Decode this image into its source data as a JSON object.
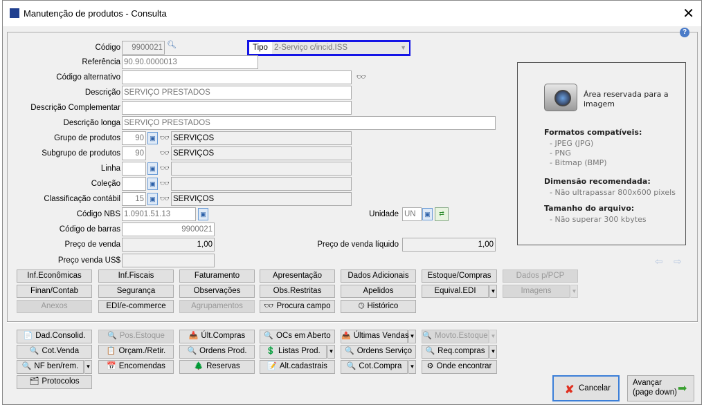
{
  "window": {
    "title": "Manutenção de produtos - Consulta"
  },
  "form": {
    "codigo": {
      "label": "Código",
      "value": "9900021"
    },
    "tipo": {
      "label": "Tipo",
      "value": "2-Serviço c/incid.ISS"
    },
    "referencia": {
      "label": "Referência",
      "value": "90.90.0000013"
    },
    "codigo_alternativo": {
      "label": "Código alternativo",
      "value": ""
    },
    "descricao": {
      "label": "Descrição",
      "value": "SERVIÇO PRESTADOS"
    },
    "descricao_complementar": {
      "label": "Descrição Complementar",
      "value": ""
    },
    "descricao_longa": {
      "label": "Descrição longa",
      "value": "SERVIÇO PRESTADOS"
    },
    "grupo": {
      "label": "Grupo de produtos",
      "code": "90",
      "desc": "SERVIÇOS"
    },
    "subgrupo": {
      "label": "Subgrupo de produtos",
      "code": "90",
      "desc": "SERVIÇOS"
    },
    "linha": {
      "label": "Linha",
      "code": "",
      "desc": ""
    },
    "colecao": {
      "label": "Coleção",
      "code": "",
      "desc": ""
    },
    "classificacao": {
      "label": "Classificação contábil",
      "code": "15",
      "desc": "SERVIÇOS"
    },
    "nbs": {
      "label": "Código NBS",
      "value": "1.0901.51.13"
    },
    "unidade": {
      "label": "Unidade",
      "value": "UN"
    },
    "barras": {
      "label": "Código de barras",
      "value": "9900021"
    },
    "preco_venda": {
      "label": "Preço de venda",
      "value": "1,00"
    },
    "preco_liquido": {
      "label": "Preço de venda líquido",
      "value": "1,00"
    },
    "preco_usd": {
      "label": "Preço venda US$",
      "value": ""
    }
  },
  "image_area": {
    "title": "Área reservada para a imagem",
    "formats_title": "Formatos compatíveis:",
    "formats": [
      "- JPEG (JPG)",
      "- PNG",
      "- Bitmap (BMP)"
    ],
    "dim_title": "Dimensão recomendada:",
    "dim": "- Não ultrapassar 800x600 pixels",
    "size_title": "Tamanho do arquivo:",
    "size": "- Não superar 300 kbytes"
  },
  "tab_buttons": [
    [
      "Inf.Econômicas",
      "Inf.Fiscais",
      "Faturamento",
      "Apresentação",
      "Dados Adicionais",
      "Estoque/Compras",
      "Dados p/PCP"
    ],
    [
      "Finan/Contab",
      "Segurança",
      "Observações",
      "Obs.Restritas",
      "Apelidos",
      "Equival.EDI",
      "Imagens"
    ],
    [
      "Anexos",
      "EDI/e-commerce",
      "Agrupamentos",
      "Procura campo",
      "Histórico"
    ]
  ],
  "action_buttons": [
    [
      "Dad.Consolid.",
      "Pos.Estoque",
      "Últ.Compras",
      "OCs em Aberto",
      "Últimas Vendas",
      "Movto.Estoque"
    ],
    [
      "Cot.Venda",
      "Orçam./Retir.",
      "Ordens Prod.",
      "Listas Prod.",
      "Ordens Serviço",
      "Req.compras"
    ],
    [
      "NF ben/rem.",
      "Encomendas",
      "Reservas",
      "Alt.cadastrais",
      "Cot.Compra",
      "Onde encontrar"
    ],
    [
      "Protocolos"
    ]
  ],
  "footer": {
    "cancel": "Cancelar",
    "next": "Avançar",
    "next_sub": "(page down)"
  }
}
